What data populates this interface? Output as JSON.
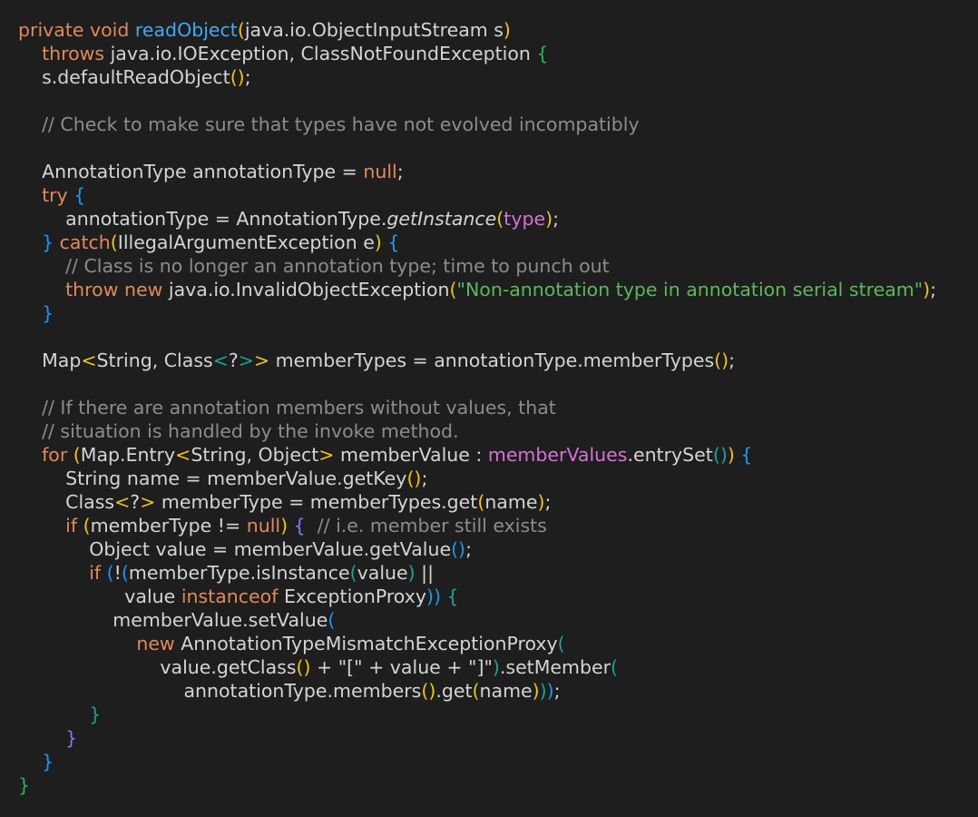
{
  "editor": {
    "language": "java",
    "colors": {
      "background": "#1e1e1e",
      "plain": "#d4d4d4",
      "keyword": "#e0895a",
      "function": "#43a9f2",
      "string": "#5cb85c",
      "comment": "#8c8c8c",
      "purple": "#d373d3",
      "bracket_gold": "#f0c419",
      "bracket_teal": "#1aa39a",
      "bracket_blue": "#1a97f5",
      "bracket_green": "#1db954",
      "bracket_violet": "#7a7aff"
    },
    "lines": [
      {
        "tokens": [
          {
            "t": "private void ",
            "c": "kw"
          },
          {
            "t": "readObject",
            "c": "fn"
          },
          {
            "t": "(",
            "c": "gold"
          },
          {
            "t": "java.io.ObjectInputStream s",
            "c": "plain"
          },
          {
            "t": ")",
            "c": "gold"
          }
        ]
      },
      {
        "tokens": [
          {
            "t": "    "
          },
          {
            "t": "throws",
            "c": "kw"
          },
          {
            "t": " java.io.IOException, ClassNotFoundException ",
            "c": "plain"
          },
          {
            "t": "{",
            "c": "green"
          }
        ]
      },
      {
        "tokens": [
          {
            "t": "    "
          },
          {
            "t": "s.defaultReadObject",
            "c": "plain"
          },
          {
            "t": "()",
            "c": "gold"
          },
          {
            "t": ";",
            "c": "plain"
          }
        ]
      },
      {
        "tokens": []
      },
      {
        "tokens": [
          {
            "t": "    "
          },
          {
            "t": "// Check to make sure that types have not evolved incompatibly",
            "c": "cm"
          }
        ]
      },
      {
        "tokens": []
      },
      {
        "tokens": [
          {
            "t": "    "
          },
          {
            "t": "AnnotationType annotationType = ",
            "c": "plain"
          },
          {
            "t": "null",
            "c": "kw"
          },
          {
            "t": ";",
            "c": "plain"
          }
        ]
      },
      {
        "tokens": [
          {
            "t": "    "
          },
          {
            "t": "try",
            "c": "kw"
          },
          {
            "t": " "
          },
          {
            "t": "{",
            "c": "blue"
          }
        ]
      },
      {
        "tokens": [
          {
            "t": "        "
          },
          {
            "t": "annotationType = AnnotationType.",
            "c": "plain"
          },
          {
            "t": "getInstance",
            "c": "plain",
            "i": true
          },
          {
            "t": "(",
            "c": "gold"
          },
          {
            "t": "type",
            "c": "purple"
          },
          {
            "t": ")",
            "c": "gold"
          },
          {
            "t": ";",
            "c": "plain"
          }
        ]
      },
      {
        "tokens": [
          {
            "t": "    "
          },
          {
            "t": "}",
            "c": "blue"
          },
          {
            "t": " "
          },
          {
            "t": "catch",
            "c": "kw"
          },
          {
            "t": "(",
            "c": "gold"
          },
          {
            "t": "IllegalArgumentException e",
            "c": "plain"
          },
          {
            "t": ")",
            "c": "gold"
          },
          {
            "t": " "
          },
          {
            "t": "{",
            "c": "blue"
          }
        ]
      },
      {
        "tokens": [
          {
            "t": "        "
          },
          {
            "t": "// Class is no longer an annotation type; time to punch out",
            "c": "cm"
          }
        ]
      },
      {
        "tokens": [
          {
            "t": "        "
          },
          {
            "t": "throw new",
            "c": "kw"
          },
          {
            "t": " java.io.InvalidObjectException",
            "c": "plain"
          },
          {
            "t": "(",
            "c": "gold"
          },
          {
            "t": "\"Non-annotation type in annotation serial stream\"",
            "c": "str"
          },
          {
            "t": ")",
            "c": "gold"
          },
          {
            "t": ";",
            "c": "plain"
          }
        ]
      },
      {
        "tokens": [
          {
            "t": "    "
          },
          {
            "t": "}",
            "c": "blue"
          }
        ]
      },
      {
        "tokens": []
      },
      {
        "tokens": [
          {
            "t": "    "
          },
          {
            "t": "Map",
            "c": "plain"
          },
          {
            "t": "<",
            "c": "gold"
          },
          {
            "t": "String, Class",
            "c": "plain"
          },
          {
            "t": "<",
            "c": "teal"
          },
          {
            "t": "?",
            "c": "plain"
          },
          {
            "t": ">",
            "c": "teal"
          },
          {
            "t": ">",
            "c": "gold"
          },
          {
            "t": " memberTypes = annotationType.memberTypes",
            "c": "plain"
          },
          {
            "t": "()",
            "c": "gold"
          },
          {
            "t": ";",
            "c": "plain"
          }
        ]
      },
      {
        "tokens": []
      },
      {
        "tokens": [
          {
            "t": "    "
          },
          {
            "t": "// If there are annotation members without values, that",
            "c": "cm"
          }
        ]
      },
      {
        "tokens": [
          {
            "t": "    "
          },
          {
            "t": "// situation is handled by the invoke method.",
            "c": "cm"
          }
        ]
      },
      {
        "tokens": [
          {
            "t": "    "
          },
          {
            "t": "for",
            "c": "kw"
          },
          {
            "t": " "
          },
          {
            "t": "(",
            "c": "gold"
          },
          {
            "t": "Map.Entry",
            "c": "plain"
          },
          {
            "t": "<",
            "c": "gold"
          },
          {
            "t": "String, Object",
            "c": "plain"
          },
          {
            "t": ">",
            "c": "gold"
          },
          {
            "t": " memberValue : ",
            "c": "plain"
          },
          {
            "t": "memberValues",
            "c": "purple"
          },
          {
            "t": ".entrySet",
            "c": "plain"
          },
          {
            "t": "()",
            "c": "teal"
          },
          {
            "t": ")",
            "c": "gold"
          },
          {
            "t": " "
          },
          {
            "t": "{",
            "c": "blue"
          }
        ]
      },
      {
        "tokens": [
          {
            "t": "        "
          },
          {
            "t": "String name = memberValue.getKey",
            "c": "plain"
          },
          {
            "t": "()",
            "c": "gold"
          },
          {
            "t": ";",
            "c": "plain"
          }
        ]
      },
      {
        "tokens": [
          {
            "t": "        "
          },
          {
            "t": "Class",
            "c": "plain"
          },
          {
            "t": "<",
            "c": "gold"
          },
          {
            "t": "?",
            "c": "plain"
          },
          {
            "t": ">",
            "c": "gold"
          },
          {
            "t": " memberType = memberTypes.get",
            "c": "plain"
          },
          {
            "t": "(",
            "c": "gold"
          },
          {
            "t": "name",
            "c": "plain"
          },
          {
            "t": ")",
            "c": "gold"
          },
          {
            "t": ";",
            "c": "plain"
          }
        ]
      },
      {
        "tokens": [
          {
            "t": "        "
          },
          {
            "t": "if",
            "c": "kw"
          },
          {
            "t": " "
          },
          {
            "t": "(",
            "c": "gold"
          },
          {
            "t": "memberType != ",
            "c": "plain"
          },
          {
            "t": "null",
            "c": "kw"
          },
          {
            "t": ")",
            "c": "gold"
          },
          {
            "t": " "
          },
          {
            "t": "{",
            "c": "violet"
          },
          {
            "t": "  "
          },
          {
            "t": "// i.e. member still exists",
            "c": "cm"
          }
        ]
      },
      {
        "tokens": [
          {
            "t": "            "
          },
          {
            "t": "Object value = memberValue.getValue",
            "c": "plain"
          },
          {
            "t": "()",
            "c": "blue"
          },
          {
            "t": ";",
            "c": "plain"
          }
        ]
      },
      {
        "tokens": [
          {
            "t": "            "
          },
          {
            "t": "if",
            "c": "kw"
          },
          {
            "t": " "
          },
          {
            "t": "(",
            "c": "blue"
          },
          {
            "t": "!",
            "c": "plain"
          },
          {
            "t": "(",
            "c": "blue"
          },
          {
            "t": "memberType.isInstance",
            "c": "plain"
          },
          {
            "t": "(",
            "c": "teal"
          },
          {
            "t": "value",
            "c": "plain"
          },
          {
            "t": ")",
            "c": "teal"
          },
          {
            "t": " ||",
            "c": "plain"
          }
        ]
      },
      {
        "tokens": [
          {
            "t": "                  "
          },
          {
            "t": "value ",
            "c": "plain"
          },
          {
            "t": "instanceof",
            "c": "kw"
          },
          {
            "t": " ExceptionProxy",
            "c": "plain"
          },
          {
            "t": "))",
            "c": "blue"
          },
          {
            "t": " "
          },
          {
            "t": "{",
            "c": "teal"
          }
        ]
      },
      {
        "tokens": [
          {
            "t": "                "
          },
          {
            "t": "memberValue.setValue",
            "c": "plain"
          },
          {
            "t": "(",
            "c": "blue"
          }
        ]
      },
      {
        "tokens": [
          {
            "t": "                    "
          },
          {
            "t": "new",
            "c": "kw"
          },
          {
            "t": " AnnotationTypeMismatchExceptionProxy",
            "c": "plain"
          },
          {
            "t": "(",
            "c": "teal"
          }
        ]
      },
      {
        "tokens": [
          {
            "t": "                        "
          },
          {
            "t": "value.getClass",
            "c": "plain"
          },
          {
            "t": "()",
            "c": "gold"
          },
          {
            "t": " + ",
            "c": "plain"
          },
          {
            "t": "\"[\"",
            "c": "plain"
          },
          {
            "t": " + value + ",
            "c": "plain"
          },
          {
            "t": "\"]\"",
            "c": "plain"
          },
          {
            "t": ")",
            "c": "teal"
          },
          {
            "t": ".setMember",
            "c": "plain"
          },
          {
            "t": "(",
            "c": "teal"
          }
        ]
      },
      {
        "tokens": [
          {
            "t": "                            "
          },
          {
            "t": "annotationType.members",
            "c": "plain"
          },
          {
            "t": "()",
            "c": "gold"
          },
          {
            "t": ".get",
            "c": "plain"
          },
          {
            "t": "(",
            "c": "gold"
          },
          {
            "t": "name",
            "c": "plain"
          },
          {
            "t": ")",
            "c": "gold"
          },
          {
            "t": ")",
            "c": "teal"
          },
          {
            "t": ")",
            "c": "blue"
          },
          {
            "t": ";",
            "c": "plain"
          }
        ]
      },
      {
        "tokens": [
          {
            "t": "            "
          },
          {
            "t": "}",
            "c": "teal"
          }
        ]
      },
      {
        "tokens": [
          {
            "t": "        "
          },
          {
            "t": "}",
            "c": "violet"
          }
        ]
      },
      {
        "tokens": [
          {
            "t": "    "
          },
          {
            "t": "}",
            "c": "blue"
          }
        ]
      },
      {
        "tokens": [
          {
            "t": "}",
            "c": "green"
          }
        ]
      }
    ]
  }
}
